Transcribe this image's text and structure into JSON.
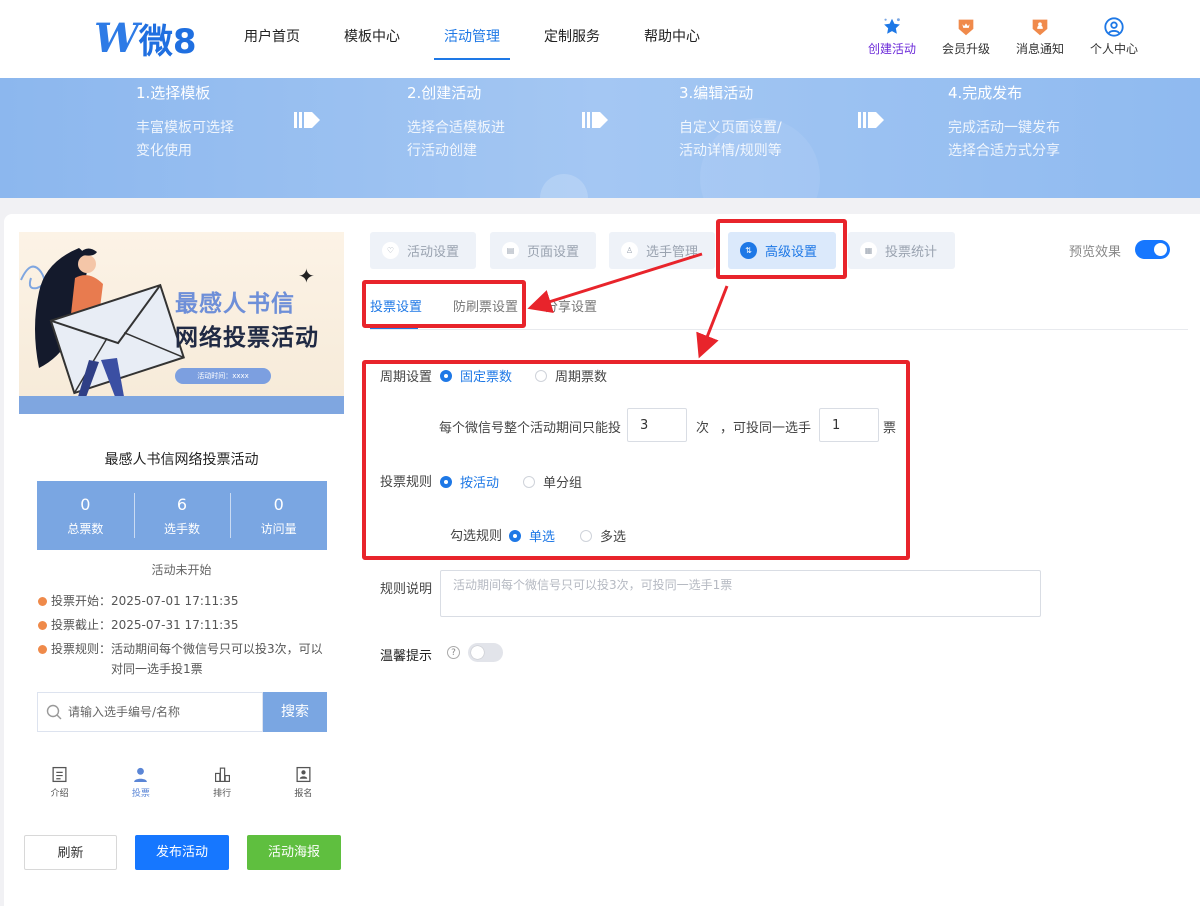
{
  "header": {
    "logo_text": "微8",
    "nav": [
      "用户首页",
      "模板中心",
      "活动管理",
      "定制服务",
      "帮助中心"
    ],
    "active_nav": "活动管理",
    "right_items": [
      {
        "label": "创建活动",
        "icon": "star-icon"
      },
      {
        "label": "会员升级",
        "icon": "crown-badge-icon"
      },
      {
        "label": "消息通知",
        "icon": "bell-badge-icon"
      },
      {
        "label": "个人中心",
        "icon": "user-circle-icon"
      }
    ]
  },
  "steps": [
    {
      "title": "1.选择模板",
      "desc1": "丰富模板可选择",
      "desc2": "变化使用"
    },
    {
      "title": "2.创建活动",
      "desc1": "选择合适模板进",
      "desc2": "行活动创建"
    },
    {
      "title": "3.编辑活动",
      "desc1": "自定义页面设置/",
      "desc2": "活动详情/规则等"
    },
    {
      "title": "4.完成发布",
      "desc1": "完成活动一键发布",
      "desc2": "选择合适方式分享"
    }
  ],
  "preview": {
    "poster_title1": "最感人书信",
    "poster_title2": "网络投票活动",
    "poster_time": "活动时间：xxxx",
    "activity_title": "最感人书信网络投票活动",
    "stats": [
      {
        "value": "0",
        "label": "总票数"
      },
      {
        "value": "6",
        "label": "选手数"
      },
      {
        "value": "0",
        "label": "访问量"
      }
    ],
    "status": "活动未开始",
    "vote_start": "投票开始：2025-07-01 17:11:35",
    "vote_end": "投票截止：2025-07-31 17:11:35",
    "rule_label": "投票规则：",
    "rule_text": "活动期间每个微信号只可以投3次，可以对同一选手投1票",
    "search_placeholder": "请输入选手编号/名称",
    "search_button": "搜索",
    "tabs": [
      "介绍",
      "投票",
      "排行",
      "报名"
    ],
    "active_tab": "投票",
    "buttons": {
      "refresh": "刷新",
      "publish": "发布活动",
      "poster": "活动海报"
    }
  },
  "settings": {
    "main_tabs": [
      "活动设置",
      "页面设置",
      "选手管理",
      "高级设置",
      "投票统计"
    ],
    "active_main_tab": "高级设置",
    "preview_label": "预览效果",
    "preview_on": true,
    "sub_tabs": [
      "投票设置",
      "防刷票设置",
      "分享设置"
    ],
    "active_sub_tab": "投票设置",
    "cycle": {
      "label": "周期设置",
      "options": [
        "固定票数",
        "周期票数"
      ],
      "selected": "固定票数",
      "text1": "每个微信号整个活动期间只能投",
      "times_value": "3",
      "unit_times": "次",
      "text2": "，可投同一选手",
      "same_value": "1",
      "unit_votes": "票"
    },
    "vote_rule": {
      "label": "投票规则",
      "options": [
        "按活动",
        "单分组"
      ],
      "selected": "按活动"
    },
    "check_rule": {
      "label": "勾选规则",
      "options": [
        "单选",
        "多选"
      ],
      "selected": "单选"
    },
    "rule_desc": {
      "label": "规则说明",
      "placeholder": "活动期间每个微信号只可以投3次，可投同一选手1票"
    },
    "tips": {
      "label": "温馨提示",
      "enabled": false
    }
  },
  "colors": {
    "primary": "#1e78e6",
    "banner": "#9fc3f1",
    "stats_bg": "#7aa6e2",
    "annotation_red": "#e8242b",
    "green_button": "#5fbf3f"
  }
}
